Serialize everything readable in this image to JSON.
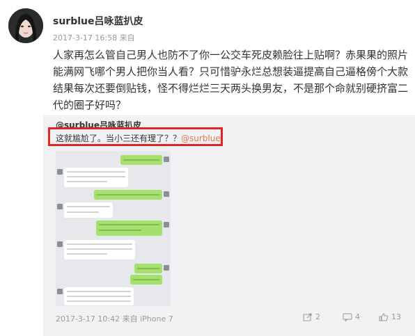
{
  "post": {
    "username": "surblue吕咏蓝扒皮",
    "timestamp": "2017-3-17 16:58",
    "source": "来自",
    "text": "人家再怎么管自己男人也防不了你一公交车死皮赖脸往上贴啊？赤果果的照片能满网飞哪个男人把你当人看？只可惜驴永烂总想装逼提高自己逼格傍个大款结果每次还要倒贴钱，怪不得烂烂三天两头换男友，不是那个命就别硬挤富二代的圈子好吗？"
  },
  "repost": {
    "username": "@surblue吕咏蓝扒皮",
    "quote_text": "这就尴尬了。当小三还有理了？？",
    "quote_mention": "@surblue",
    "footer": "2017-3-17 10:42 来自 iPhone 7",
    "actions": {
      "share_count": "2",
      "comment_count": "4",
      "like_count": "13"
    }
  },
  "icons": {
    "share": "share-icon",
    "comment": "comment-icon",
    "like": "thumbs-up-icon"
  },
  "colors": {
    "highlight_border": "#e32424",
    "mention": "#eb7350",
    "repost_bg": "#f2f2f5"
  }
}
